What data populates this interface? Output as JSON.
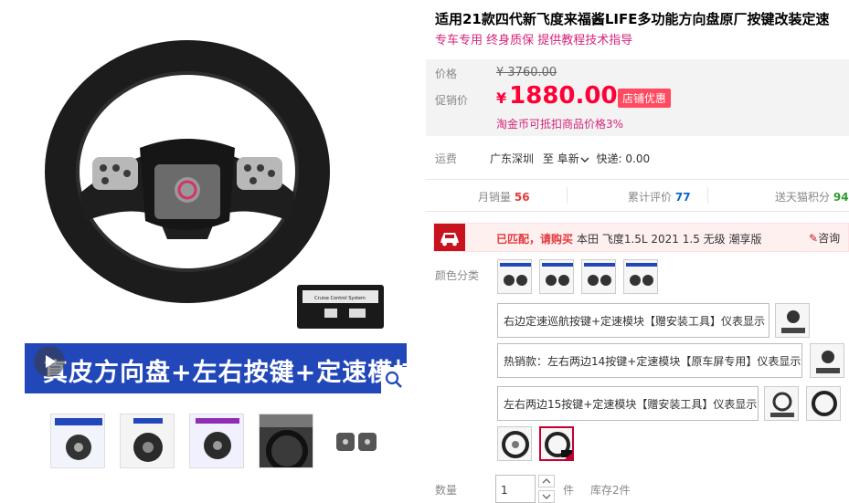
{
  "product": {
    "title": "适用21款四代新飞度来福酱LIFE多功能方向盘原厂按键改装定速",
    "subtitle": "专车专用 终身质保 提供教程技术指导",
    "banner_text": "真皮方向盘+左右按键+定速模块",
    "module_label": "Cruise Control System"
  },
  "price": {
    "orig_label": "价格",
    "orig_value": "¥ 3760.00",
    "sale_label": "促销价",
    "currency": "¥",
    "sale_value": "1880.00",
    "shop_badge": "店铺优惠",
    "coin_text": "淘金币可抵扣商品价格3%"
  },
  "shipping": {
    "label": "运费",
    "from": "广东深圳",
    "to_word": "至",
    "to": "阜新",
    "chevron": "chevron-down-icon",
    "express": "快递: 0.00"
  },
  "stats": {
    "monthly_label": "月销量",
    "monthly_value": "56",
    "reviews_label": "累计评价",
    "reviews_value": "77",
    "points_label": "送天猫积分",
    "points_value": "94"
  },
  "match": {
    "label": "已匹配，请购买",
    "value": "本田 飞度1.5L 2021 1.5 无级 潮享版",
    "consult": "咨询",
    "icon": "car-icon"
  },
  "sku": {
    "label": "颜色分类",
    "options": [
      "右边定速巡航按键+定速模块【赠安装工具】仪表显示",
      "热销款：左右两边14按键+定速模块【原车屏专用】仪表显示",
      "左右两边15按键+定速模块【赠安装工具】仪表显示"
    ]
  },
  "quantity": {
    "label": "数量",
    "value": "1",
    "unit": "件",
    "stock": "库存2件"
  },
  "colors": {
    "price_red": "#ff0036",
    "promo_pink": "#d4237a",
    "banner_blue": "#2147b8",
    "match_red": "#c8121e"
  }
}
